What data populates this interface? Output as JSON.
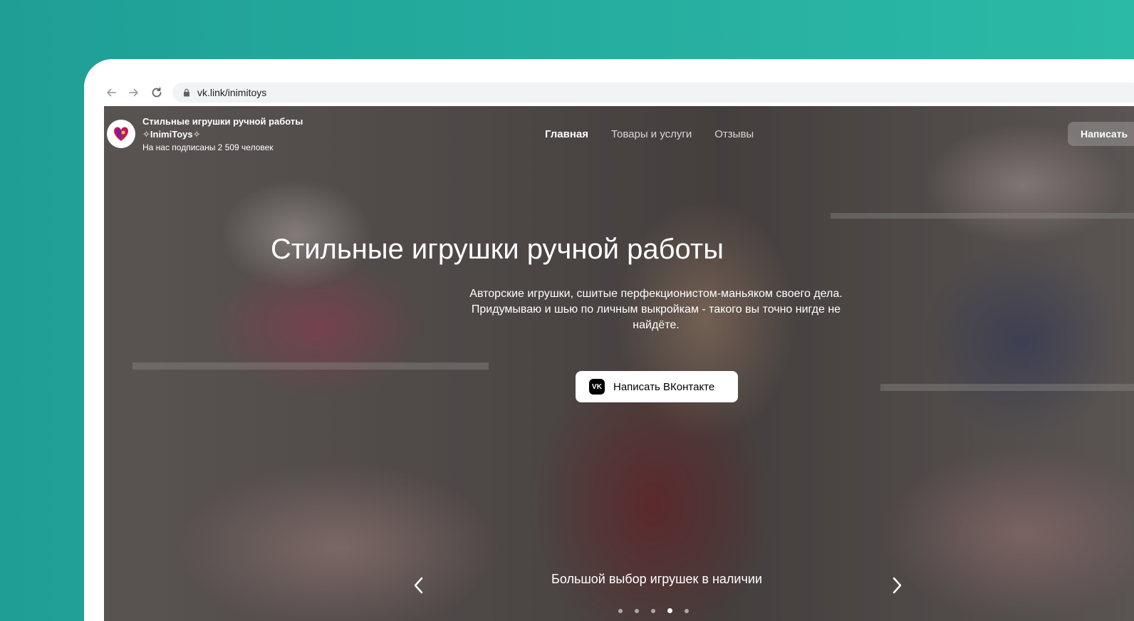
{
  "browser": {
    "url": "vk.link/inimitoys"
  },
  "community": {
    "name": "Стильные игрушки ручной работы ✧InimiToys✧",
    "followers": "На нас подписаны 2 509 человек"
  },
  "nav": {
    "tabs": [
      "Главная",
      "Товары и услуги",
      "Отзывы"
    ],
    "active": "Главная",
    "write_button": "Написать"
  },
  "hero": {
    "title": "Стильные игрушки ручной работы",
    "description": "Авторские игрушки, сшитые перфекционистом-маньяком своего дела. Придумываю и шью по личным выкройкам - такого вы точно нигде не найдёте.",
    "cta_label": "Написать ВКонтакте",
    "slide_caption": "Большой выбор игрушек в наличии",
    "slide_count": 5,
    "active_slide": 4
  },
  "colors": {
    "background": "#25ad9f",
    "accent": "#ffffff"
  },
  "icons": {
    "back": "arrow-left-icon",
    "forward": "arrow-right-icon",
    "reload": "reload-icon",
    "lock": "lock-icon",
    "vk": "vk-logo-icon",
    "prev": "chevron-left-icon",
    "next": "chevron-right-icon"
  }
}
